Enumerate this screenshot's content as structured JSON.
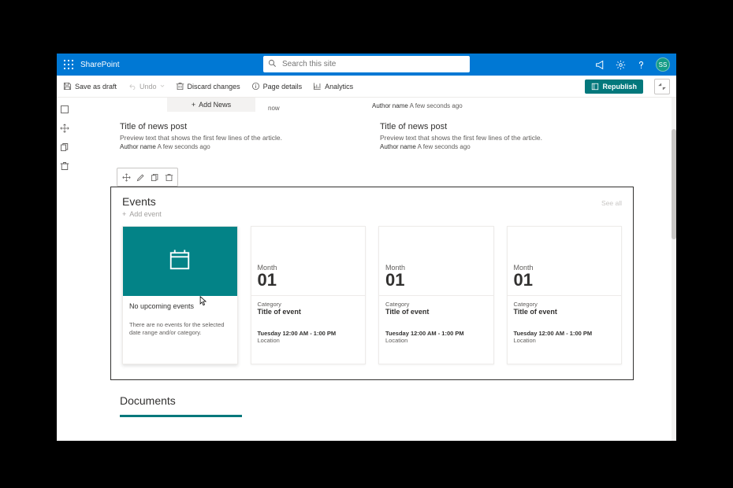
{
  "suite": {
    "brand": "SharePoint",
    "search_placeholder": "Search this site",
    "avatar_initials": "SS"
  },
  "cmdbar": {
    "save_draft": "Save as draft",
    "undo": "Undo",
    "discard": "Discard changes",
    "page_details": "Page details",
    "analytics": "Analytics",
    "republish": "Republish"
  },
  "news": {
    "add_news": "Add News",
    "now_label": "now",
    "top_right_author": "Author name",
    "top_right_ts": "A few seconds ago",
    "posts": [
      {
        "title": "Title of news post",
        "preview": "Preview text that shows the first few lines of the article.",
        "author": "Author name",
        "ts": "A few seconds ago"
      },
      {
        "title": "Title of news post",
        "preview": "Preview text that shows the first few lines of the article.",
        "author": "Author name",
        "ts": "A few seconds ago"
      }
    ]
  },
  "events": {
    "title": "Events",
    "see_all": "See all",
    "add_event": "Add event",
    "empty": {
      "title": "No upcoming events",
      "text": "There are no events for the selected date range and/or category."
    },
    "items": [
      {
        "month": "Month",
        "day": "01",
        "category": "Category",
        "title": "Title of event",
        "time": "Tuesday 12:00 AM - 1:00 PM",
        "location": "Location"
      },
      {
        "month": "Month",
        "day": "01",
        "category": "Category",
        "title": "Title of event",
        "time": "Tuesday 12:00 AM - 1:00 PM",
        "location": "Location"
      },
      {
        "month": "Month",
        "day": "01",
        "category": "Category",
        "title": "Title of event",
        "time": "Tuesday 12:00 AM - 1:00 PM",
        "location": "Location"
      }
    ]
  },
  "documents": {
    "title": "Documents"
  }
}
